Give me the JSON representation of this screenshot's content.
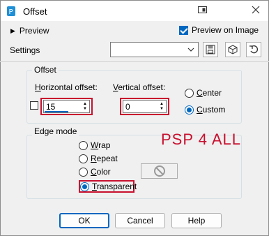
{
  "window": {
    "title": "Offset"
  },
  "toolbar": {
    "preview_label": "Preview",
    "preview_on_image_label": "Preview on Image",
    "preview_on_image_checked": true,
    "settings_label": "Settings",
    "settings_value": ""
  },
  "offset": {
    "group_title": "Offset",
    "horizontal": {
      "label_u": "H",
      "label_rest": "orizontal offset:",
      "value": "15"
    },
    "vertical": {
      "label_u": "V",
      "label_rest": "ertical offset:",
      "value": "0"
    },
    "center": {
      "label_u": "C",
      "label_rest": "enter",
      "selected": false
    },
    "custom": {
      "label_u": "C",
      "label_rest": "ustom",
      "selected": true
    }
  },
  "edge_mode": {
    "group_title": "Edge mode",
    "wrap": {
      "label_u": "W",
      "label_rest": "rap",
      "selected": false
    },
    "repeat": {
      "label_u": "R",
      "label_rest": "epeat",
      "selected": false
    },
    "color": {
      "label_u": "C",
      "label_rest": "olor",
      "selected": false
    },
    "transparent": {
      "label_u": "T",
      "label_rest": "ransparent",
      "selected": true
    }
  },
  "annotation": {
    "text": "PSP 4 ALL",
    "color": "#c8102e"
  },
  "buttons": {
    "ok": "OK",
    "cancel": "Cancel",
    "help": "Help"
  },
  "colors": {
    "accent": "#0067c0",
    "highlight_frame": "#c8102e",
    "dialog_bg": "#f0f0f0"
  },
  "icons": {
    "app": "psp-app-icon",
    "window_button": "restore-window-icon",
    "settings_buttons": [
      "save-icon",
      "delete-preset-icon",
      "reset-icon"
    ],
    "color_swatch": "no-color-icon"
  }
}
